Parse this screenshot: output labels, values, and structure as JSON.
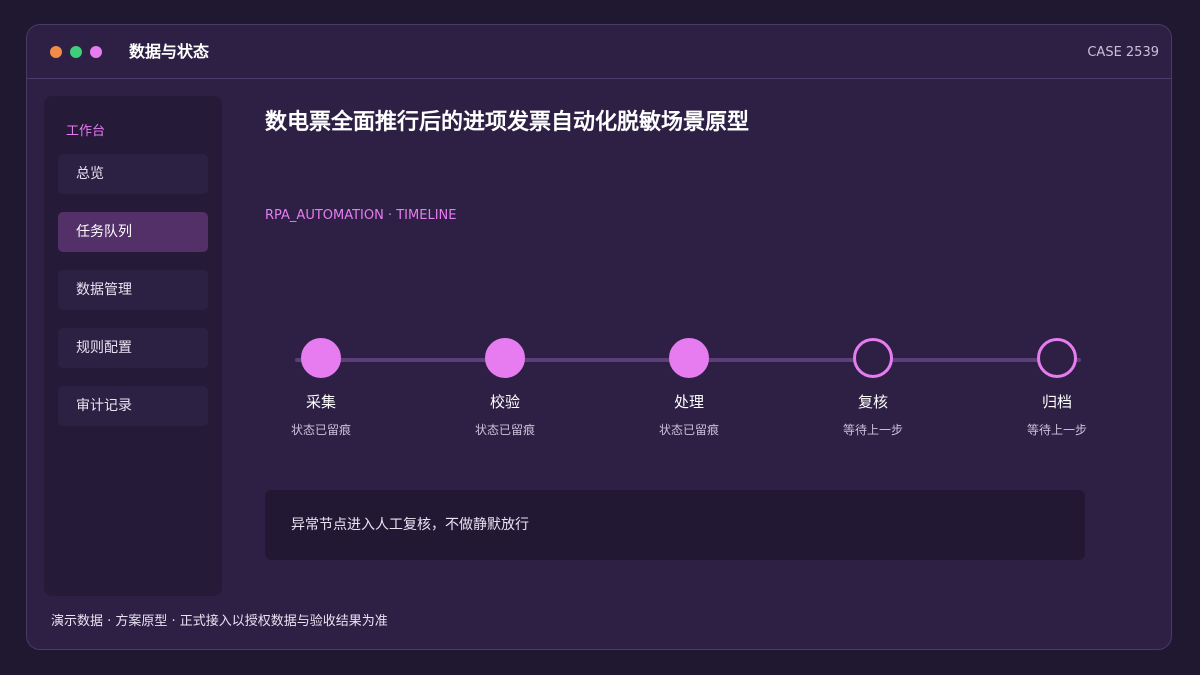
{
  "window": {
    "title": "数据与状态",
    "case_id": "CASE 2539",
    "traffic_light_colors": [
      "#f08c48",
      "#3ecf7a",
      "#e77cf0"
    ]
  },
  "sidebar": {
    "heading": "工作台",
    "items": [
      {
        "label": "总览",
        "active": false
      },
      {
        "label": "任务队列",
        "active": true
      },
      {
        "label": "数据管理",
        "active": false
      },
      {
        "label": "规则配置",
        "active": false
      },
      {
        "label": "审计记录",
        "active": false
      }
    ]
  },
  "main": {
    "title": "数电票全面推行后的进项发票自动化脱敏场景原型",
    "subtitle": "RPA_AUTOMATION · TIMELINE",
    "timeline": [
      {
        "label": "采集",
        "status": "状态已留痕",
        "completed": true
      },
      {
        "label": "校验",
        "status": "状态已留痕",
        "completed": true
      },
      {
        "label": "处理",
        "status": "状态已留痕",
        "completed": true
      },
      {
        "label": "复核",
        "status": "等待上一步",
        "completed": false
      },
      {
        "label": "归档",
        "status": "等待上一步",
        "completed": false
      }
    ],
    "notice": "异常节点进入人工复核，不做静默放行"
  },
  "footer": "演示数据 · 方案原型 · 正式接入以授权数据与验收结果为准",
  "colors": {
    "accent": "#e77cf0",
    "background": "#1f1830",
    "panel": "#2d2044",
    "active_item": "#533068"
  }
}
